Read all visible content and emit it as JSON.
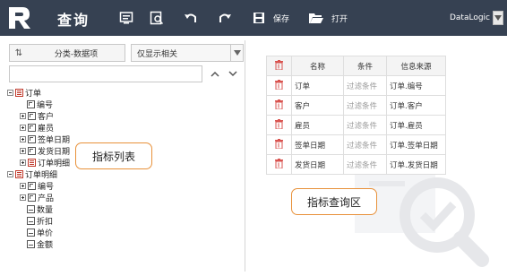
{
  "toolbar": {
    "title": "查询",
    "save_label": "保存",
    "open_label": "打开",
    "user": "DataLogic",
    "colors": {
      "bar": "#364152",
      "accent": "#e8913a"
    }
  },
  "left": {
    "sort_label": "分类-数据项",
    "filter_value": "仅显示相关",
    "search_placeholder": "",
    "tree": [
      {
        "label": "订单",
        "icon": "table-icon",
        "toggle": "minus"
      },
      {
        "label": "编号",
        "icon": "dimension-icon",
        "toggle": ""
      },
      {
        "label": "客户",
        "icon": "dimension-icon",
        "toggle": "plus"
      },
      {
        "label": "雇员",
        "icon": "dimension-icon",
        "toggle": "plus"
      },
      {
        "label": "签单日期",
        "icon": "dimension-icon",
        "toggle": "plus"
      },
      {
        "label": "发货日期",
        "icon": "dimension-icon",
        "toggle": "plus"
      },
      {
        "label": "订单明细",
        "icon": "table-icon",
        "toggle": "plus"
      },
      {
        "label": "订单明细",
        "icon": "table-icon",
        "toggle": "minus"
      },
      {
        "label": "编号",
        "icon": "dimension-icon",
        "toggle": "plus"
      },
      {
        "label": "产品",
        "icon": "dimension-icon",
        "toggle": "plus"
      },
      {
        "label": "数量",
        "icon": "measure-icon",
        "toggle": ""
      },
      {
        "label": "折扣",
        "icon": "measure-icon",
        "toggle": ""
      },
      {
        "label": "单价",
        "icon": "measure-icon",
        "toggle": ""
      },
      {
        "label": "金额",
        "icon": "measure-icon",
        "toggle": ""
      }
    ],
    "callout": "指标列表"
  },
  "right": {
    "headers": [
      "名称",
      "条件",
      "信息来源"
    ],
    "rows": [
      {
        "name": "订单",
        "cond": "过滤条件",
        "source": "订单.编号"
      },
      {
        "name": "客户",
        "cond": "过滤条件",
        "source": "订单.客户"
      },
      {
        "name": "雇员",
        "cond": "过滤条件",
        "source": "订单.雇员"
      },
      {
        "name": "签单日期",
        "cond": "过滤条件",
        "source": "订单.签单日期"
      },
      {
        "name": "发货日期",
        "cond": "过滤条件",
        "source": "订单.发货日期"
      }
    ],
    "callout": "指标查询区"
  }
}
